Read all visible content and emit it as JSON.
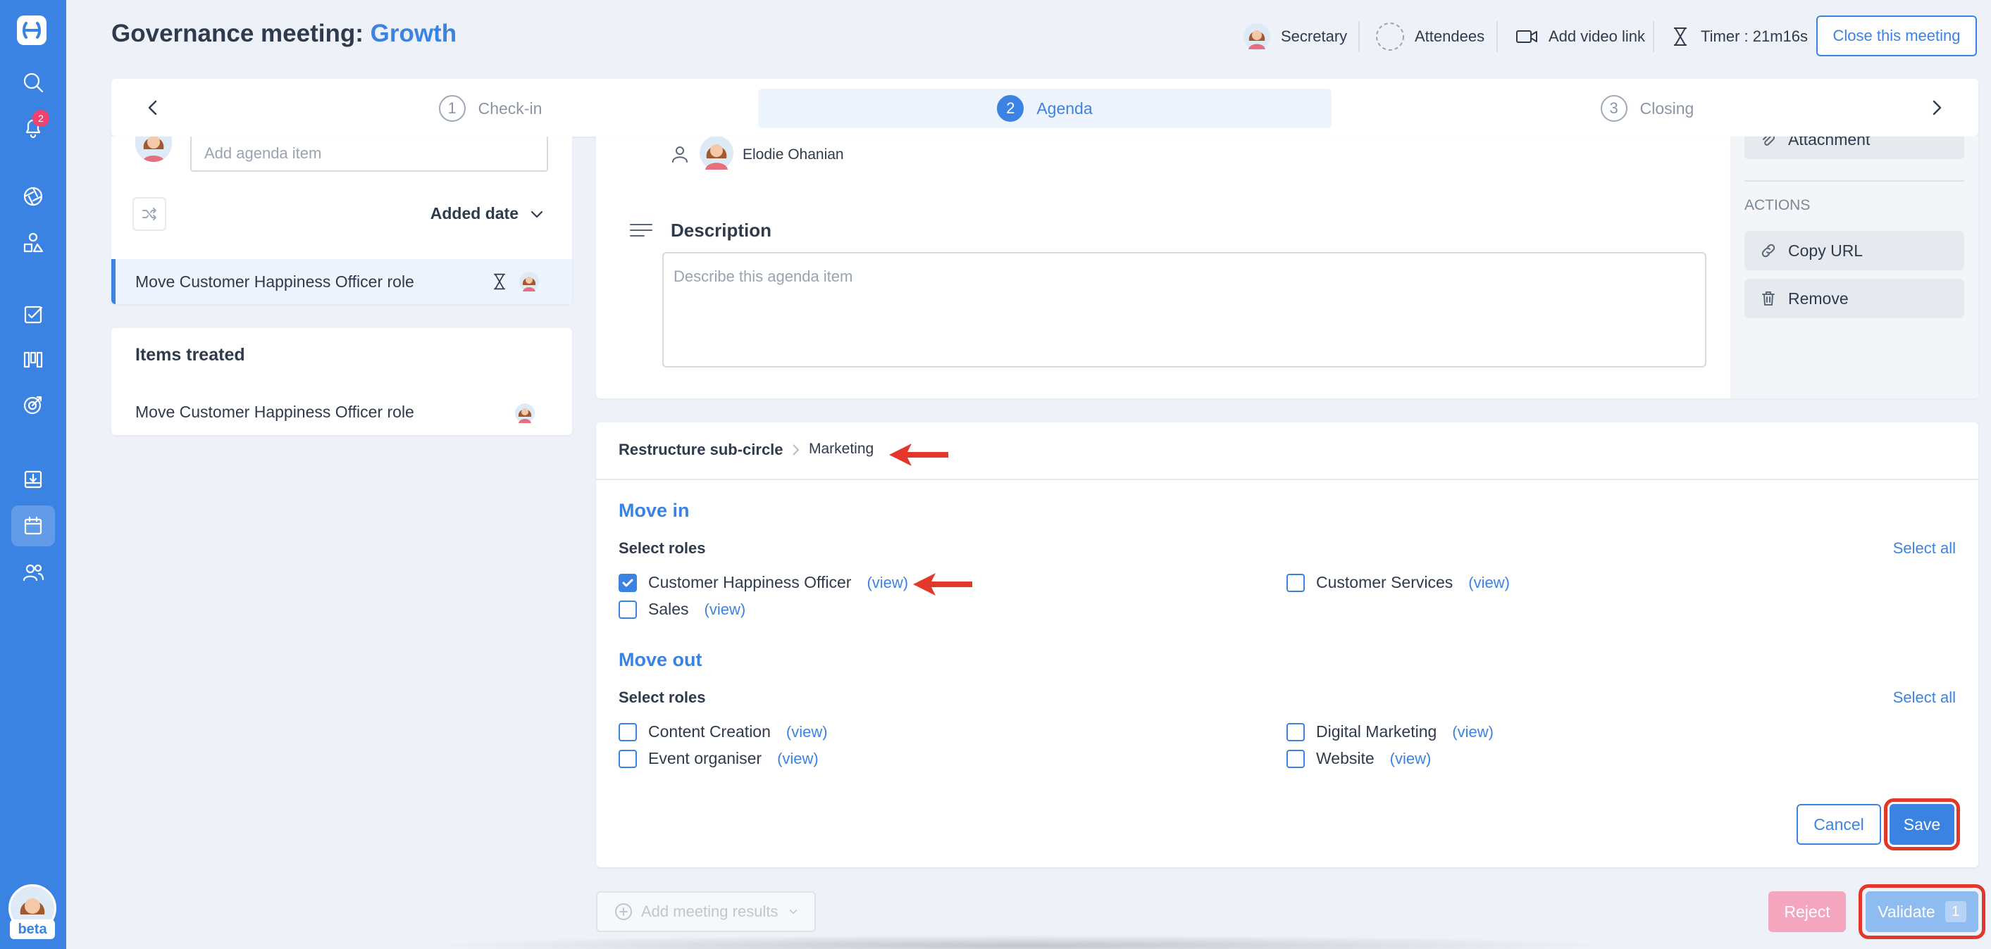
{
  "app": {
    "notifications_count": "2",
    "beta_label": "beta",
    "accent_color": "#3b83e3"
  },
  "header": {
    "title_prefix": "Governance meeting: ",
    "title_circle": "Growth",
    "secretary_label": "Secretary",
    "attendees_label": "Attendees",
    "video_label": "Add video link",
    "timer_label": "Timer : 21m16s",
    "close_label": "Close this meeting"
  },
  "stepper": {
    "steps": [
      {
        "num": "1",
        "label": "Check-in"
      },
      {
        "num": "2",
        "label": "Agenda"
      },
      {
        "num": "3",
        "label": "Closing"
      }
    ]
  },
  "agenda": {
    "input_placeholder": "Add agenda item",
    "sort_label": "Added date",
    "items": [
      {
        "label": "Move Customer Happiness Officer role"
      }
    ]
  },
  "treated": {
    "title": "Items treated",
    "items": [
      {
        "label": "Move Customer Happiness Officer role"
      }
    ]
  },
  "detail": {
    "owner_name": "Elodie Ohanian",
    "description_title": "Description",
    "description_placeholder": "Describe this agenda item",
    "attachment_label": "Attachment",
    "actions_label": "ACTIONS",
    "copy_url_label": "Copy URL",
    "remove_label": "Remove"
  },
  "restructure": {
    "breadcrumb_parent": "Restructure sub-circle",
    "breadcrumb_child": "Marketing",
    "move_in": {
      "title": "Move in",
      "select_roles_label": "Select roles",
      "select_all_label": "Select all",
      "roles": [
        {
          "name": "Customer Happiness Officer",
          "view": "(view)",
          "checked": true
        },
        {
          "name": "Customer Services",
          "view": "(view)",
          "checked": false
        },
        {
          "name": "Sales",
          "view": "(view)",
          "checked": false
        }
      ]
    },
    "move_out": {
      "title": "Move out",
      "select_roles_label": "Select roles",
      "select_all_label": "Select all",
      "roles": [
        {
          "name": "Content Creation",
          "view": "(view)",
          "checked": false
        },
        {
          "name": "Digital Marketing",
          "view": "(view)",
          "checked": false
        },
        {
          "name": "Event organiser",
          "view": "(view)",
          "checked": false
        },
        {
          "name": "Website",
          "view": "(view)",
          "checked": false
        }
      ]
    },
    "cancel_label": "Cancel",
    "save_label": "Save"
  },
  "footer": {
    "add_results_label": "Add meeting results",
    "reject_label": "Reject",
    "validate_label": "Validate",
    "validate_count": "1"
  }
}
